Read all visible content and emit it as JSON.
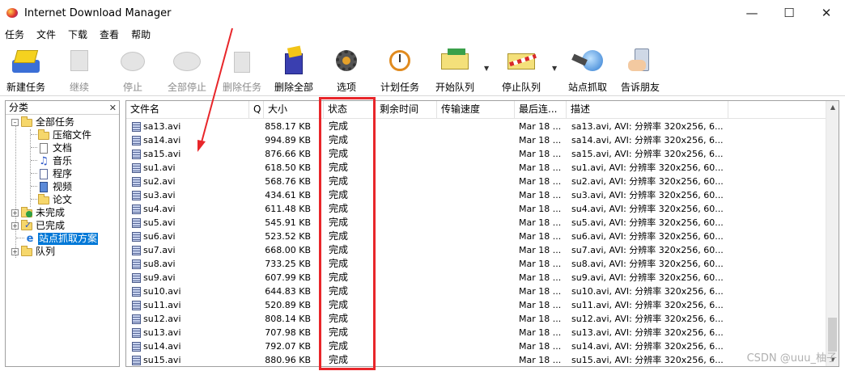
{
  "window": {
    "title": "Internet Download Manager"
  },
  "menu": [
    "任务",
    "文件",
    "下载",
    "查看",
    "帮助"
  ],
  "toolbar": {
    "new_task": "新建任务",
    "resume": "继续",
    "stop": "停止",
    "stop_all": "全部停止",
    "delete_task": "删除任务",
    "delete_all": "删除全部",
    "options": "选项",
    "scheduler": "计划任务",
    "start_queue": "开始队列",
    "stop_queue": "停止队列",
    "site_grabber": "站点抓取",
    "tell_friend": "告诉朋友"
  },
  "sidebar": {
    "header": "分类",
    "all_tasks": "全部任务",
    "compressed": "压缩文件",
    "documents": "文档",
    "music": "音乐",
    "programs": "程序",
    "video": "视频",
    "papers": "论文",
    "unfinished": "未完成",
    "finished": "已完成",
    "grabber_projects": "站点抓取方案",
    "queues": "队列"
  },
  "columns": {
    "file_name": "文件名",
    "q": "Q",
    "size": "大小",
    "status": "状态",
    "time_left": "剩余时间",
    "speed": "传输速度",
    "last_try": "最后连...",
    "description": "描述"
  },
  "rows": [
    {
      "name": "sa13.avi",
      "size": "858.17 KB",
      "status": "完成",
      "last": "Mar 18 ...",
      "desc": "sa13.avi, AVI: 分辨率 320x256, 6..."
    },
    {
      "name": "sa14.avi",
      "size": "994.89 KB",
      "status": "完成",
      "last": "Mar 18 ...",
      "desc": "sa14.avi, AVI: 分辨率 320x256, 6..."
    },
    {
      "name": "sa15.avi",
      "size": "876.66 KB",
      "status": "完成",
      "last": "Mar 18 ...",
      "desc": "sa15.avi, AVI: 分辨率 320x256, 6..."
    },
    {
      "name": "su1.avi",
      "size": "618.50 KB",
      "status": "完成",
      "last": "Mar 18 ...",
      "desc": "su1.avi, AVI: 分辨率 320x256, 60..."
    },
    {
      "name": "su2.avi",
      "size": "568.76 KB",
      "status": "完成",
      "last": "Mar 18 ...",
      "desc": "su2.avi, AVI: 分辨率 320x256, 60..."
    },
    {
      "name": "su3.avi",
      "size": "434.61 KB",
      "status": "完成",
      "last": "Mar 18 ...",
      "desc": "su3.avi, AVI: 分辨率 320x256, 60..."
    },
    {
      "name": "su4.avi",
      "size": "611.48 KB",
      "status": "完成",
      "last": "Mar 18 ...",
      "desc": "su4.avi, AVI: 分辨率 320x256, 60..."
    },
    {
      "name": "su5.avi",
      "size": "545.91 KB",
      "status": "完成",
      "last": "Mar 18 ...",
      "desc": "su5.avi, AVI: 分辨率 320x256, 60..."
    },
    {
      "name": "su6.avi",
      "size": "523.52 KB",
      "status": "完成",
      "last": "Mar 18 ...",
      "desc": "su6.avi, AVI: 分辨率 320x256, 60..."
    },
    {
      "name": "su7.avi",
      "size": "668.00 KB",
      "status": "完成",
      "last": "Mar 18 ...",
      "desc": "su7.avi, AVI: 分辨率 320x256, 60..."
    },
    {
      "name": "su8.avi",
      "size": "733.25 KB",
      "status": "完成",
      "last": "Mar 18 ...",
      "desc": "su8.avi, AVI: 分辨率 320x256, 60..."
    },
    {
      "name": "su9.avi",
      "size": "607.99 KB",
      "status": "完成",
      "last": "Mar 18 ...",
      "desc": "su9.avi, AVI: 分辨率 320x256, 60..."
    },
    {
      "name": "su10.avi",
      "size": "644.83 KB",
      "status": "完成",
      "last": "Mar 18 ...",
      "desc": "su10.avi, AVI: 分辨率 320x256, 6..."
    },
    {
      "name": "su11.avi",
      "size": "520.89 KB",
      "status": "完成",
      "last": "Mar 18 ...",
      "desc": "su11.avi, AVI: 分辨率 320x256, 6..."
    },
    {
      "name": "su12.avi",
      "size": "808.14 KB",
      "status": "完成",
      "last": "Mar 18 ...",
      "desc": "su12.avi, AVI: 分辨率 320x256, 6..."
    },
    {
      "name": "su13.avi",
      "size": "707.98 KB",
      "status": "完成",
      "last": "Mar 18 ...",
      "desc": "su13.avi, AVI: 分辨率 320x256, 6..."
    },
    {
      "name": "su14.avi",
      "size": "792.07 KB",
      "status": "完成",
      "last": "Mar 18 ...",
      "desc": "su14.avi, AVI: 分辨率 320x256, 6..."
    },
    {
      "name": "su15.avi",
      "size": "880.96 KB",
      "status": "完成",
      "last": "Mar 18 ...",
      "desc": "su15.avi, AVI: 分辨率 320x256, 6..."
    }
  ],
  "watermark": "CSDN @uuu_柚子",
  "colors": {
    "highlight": "#e8262a",
    "selection": "#0078d7"
  }
}
